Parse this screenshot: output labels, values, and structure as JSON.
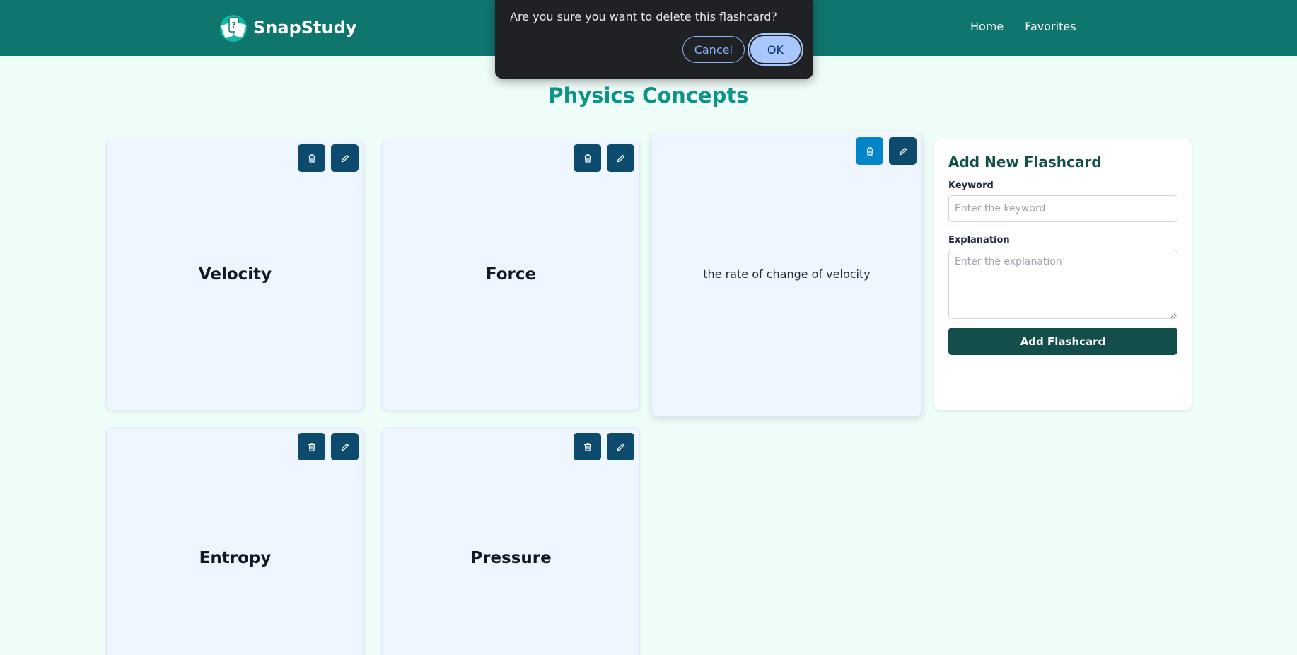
{
  "header": {
    "brand": "SnapStudy",
    "nav": [
      "Home",
      "Favorites"
    ]
  },
  "page_title": "Physics Concepts",
  "cards": [
    {
      "text": "Velocity",
      "side": "front"
    },
    {
      "text": "Force",
      "side": "front"
    },
    {
      "text": "the rate of change of velocity",
      "side": "back"
    },
    {
      "text": "Entropy",
      "side": "front"
    },
    {
      "text": "Pressure",
      "side": "front"
    }
  ],
  "form": {
    "title": "Add New Flashcard",
    "keyword_label": "Keyword",
    "keyword_placeholder": "Enter the keyword",
    "explanation_label": "Explanation",
    "explanation_placeholder": "Enter the explanation",
    "submit_label": "Add Flashcard"
  },
  "dialog": {
    "message": "Are you sure you want to delete this flashcard?",
    "cancel_label": "Cancel",
    "ok_label": "OK"
  },
  "colors": {
    "header": "#0f766e",
    "title": "#0d9488",
    "button": "#0c4a6e",
    "button_active": "#0284c7",
    "submit": "#134e4a"
  }
}
